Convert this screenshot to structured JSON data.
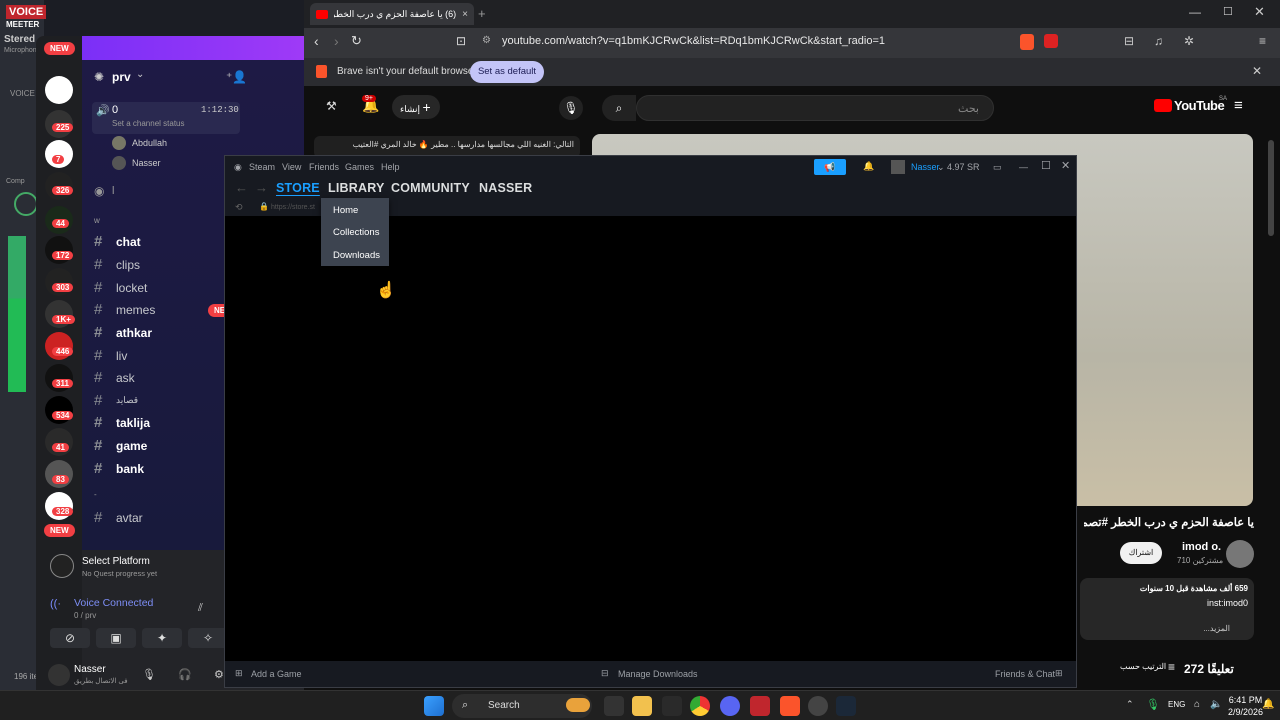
{
  "voicemeeter": {
    "brand_left": "VOICE",
    "brand_right": "MEETER",
    "labels": [
      "Stered",
      "Microphon",
      "VOICE",
      "Comp",
      "196 ite"
    ]
  },
  "discord": {
    "new_badge": "NEW",
    "server_badges": [
      "225",
      "7",
      "326",
      "44",
      "172",
      "303",
      "1K+",
      "446",
      "311",
      "534",
      "41",
      "83",
      "328"
    ],
    "server_name": "prv",
    "voice_channel": {
      "name": "0",
      "timer": "1:12:30",
      "status": "Set a channel status",
      "members": [
        "Abdullah",
        "Nasser"
      ]
    },
    "stage_channel": "l",
    "category": "w",
    "channels": [
      {
        "name": "chat",
        "bold": true
      },
      {
        "name": "clips",
        "bold": false
      },
      {
        "name": "locket",
        "bold": false
      },
      {
        "name": "memes",
        "bold": false
      },
      {
        "name": "athkar",
        "bold": true
      },
      {
        "name": "liv",
        "bold": false
      },
      {
        "name": "ask",
        "bold": false
      },
      {
        "name": "قصايد",
        "bold": false
      },
      {
        "name": "taklija",
        "bold": true
      },
      {
        "name": "game",
        "bold": true
      },
      {
        "name": "bank",
        "bold": true
      },
      {
        "name": "avtar",
        "bold": false
      }
    ],
    "category2": "-",
    "quest": {
      "title": "Select Platform",
      "subtitle": "No Quest progress yet"
    },
    "voice_connected": {
      "label": "Voice Connected",
      "sub": "0 / prv"
    },
    "user": {
      "name": "Nasser",
      "status": "فى الاتصال بطريق"
    }
  },
  "browser": {
    "tab_title": "(6) يا عاصفة الحزم ي درب الخطر #",
    "url": "youtube.com/watch?v=q1bmKJCRwCk&list=RDq1bmKJCRwCk&start_radio=1",
    "infobar_text": "Brave isn't your default browser",
    "set_default": "Set as default",
    "youtube": {
      "search_placeholder": "بحث",
      "create_label": "إنشاء",
      "notif_count": "9+",
      "logo": "YouTube",
      "logo_region": "SA",
      "up_next": "التالي: الغنيه اللي مجالسها مدارسها .. مطير 🔥 خالد المري #العتيب",
      "video_title": "يا عاصفة الحزم ي درب الخطر #تصميمي",
      "channel": "imod o.",
      "subscribers": "710 مشتركين",
      "subscribe": "اشتراك",
      "views": "659 ألف مشاهدة قبل 10 سنوات",
      "desc": "inst:imod0",
      "more": "...المزيد",
      "comments_count": "272 تعليقًا",
      "sort": "الترتيب حسب"
    }
  },
  "steam": {
    "menus": [
      "Steam",
      "View",
      "Friends",
      "Games",
      "Help"
    ],
    "nav": [
      "STORE",
      "LIBRARY",
      "COMMUNITY",
      "NASSER"
    ],
    "address": "https://store.st",
    "library_menu": [
      "Home",
      "Collections",
      "Downloads"
    ],
    "user": "Nasser",
    "wallet": "4.97 SR",
    "footer": {
      "add_game": "Add a Game",
      "manage_downloads": "Manage Downloads",
      "friends_chat": "Friends & Chat"
    }
  },
  "taskbar": {
    "search": "Search",
    "lang": "ENG",
    "time": "6:41 PM",
    "date": "2/9/2026"
  }
}
